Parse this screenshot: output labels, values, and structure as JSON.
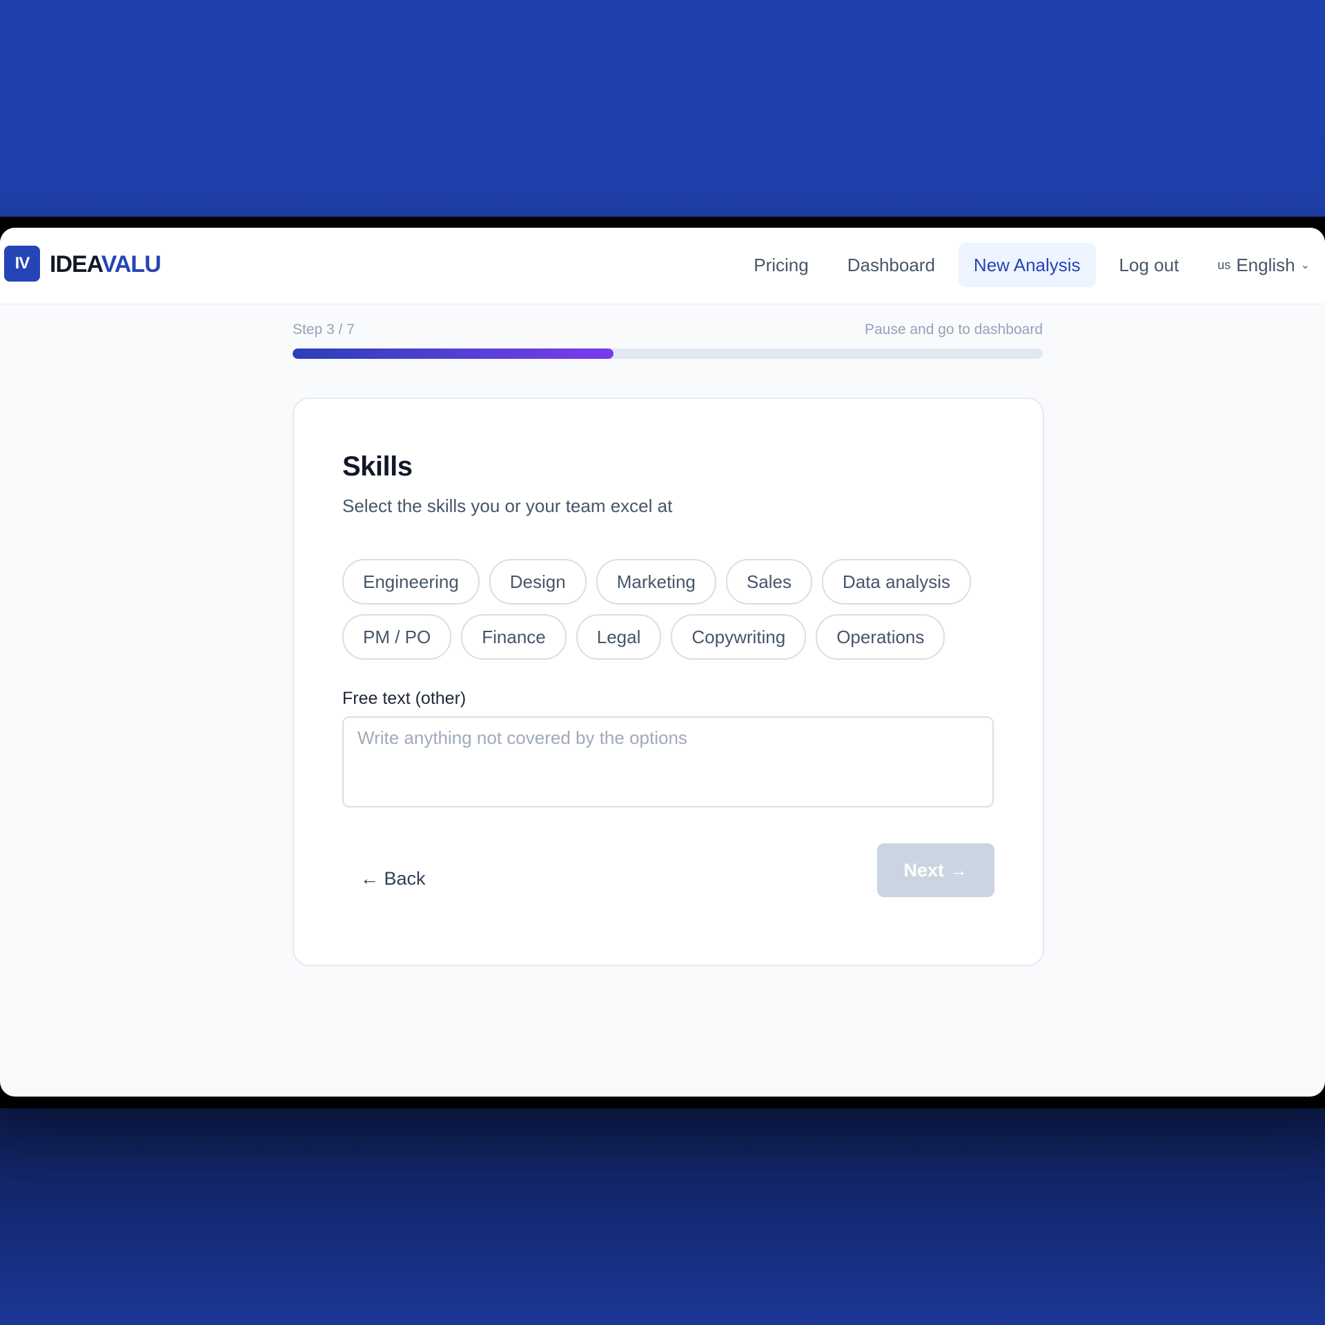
{
  "brand": {
    "mark": "IV",
    "name_part1": "IDEA",
    "name_part2": "VALU"
  },
  "nav": {
    "items": [
      {
        "label": "Pricing",
        "active": false
      },
      {
        "label": "Dashboard",
        "active": false
      },
      {
        "label": "New Analysis",
        "active": true
      },
      {
        "label": "Log out",
        "active": false
      }
    ],
    "language": {
      "flag": "us",
      "label": "English",
      "chevron": "chevron-down-icon"
    }
  },
  "progress": {
    "step_label": "Step 3 / 7",
    "pause_label": "Pause and go to dashboard",
    "current_step": 3,
    "total_steps": 7,
    "fraction": 0.428
  },
  "card": {
    "title": "Skills",
    "subtitle": "Select the skills you or your team excel at",
    "chips_row1": [
      "Engineering",
      "Design",
      "Marketing",
      "Sales",
      "Data analysis"
    ],
    "chips_row2": [
      "PM / PO",
      "Finance",
      "Legal",
      "Copywriting",
      "Operations"
    ],
    "free_text_label": "Free text (other)",
    "free_text_placeholder": "Write anything not covered by the options",
    "free_text_value": "",
    "back_label": "← Back",
    "next_label": "Next →"
  },
  "colors": {
    "brand": "#2544b5",
    "background": "#1f41ad",
    "progress_start": "#2a3fb8",
    "progress_end": "#7c3aed",
    "next_disabled": "#cbd5e1"
  }
}
